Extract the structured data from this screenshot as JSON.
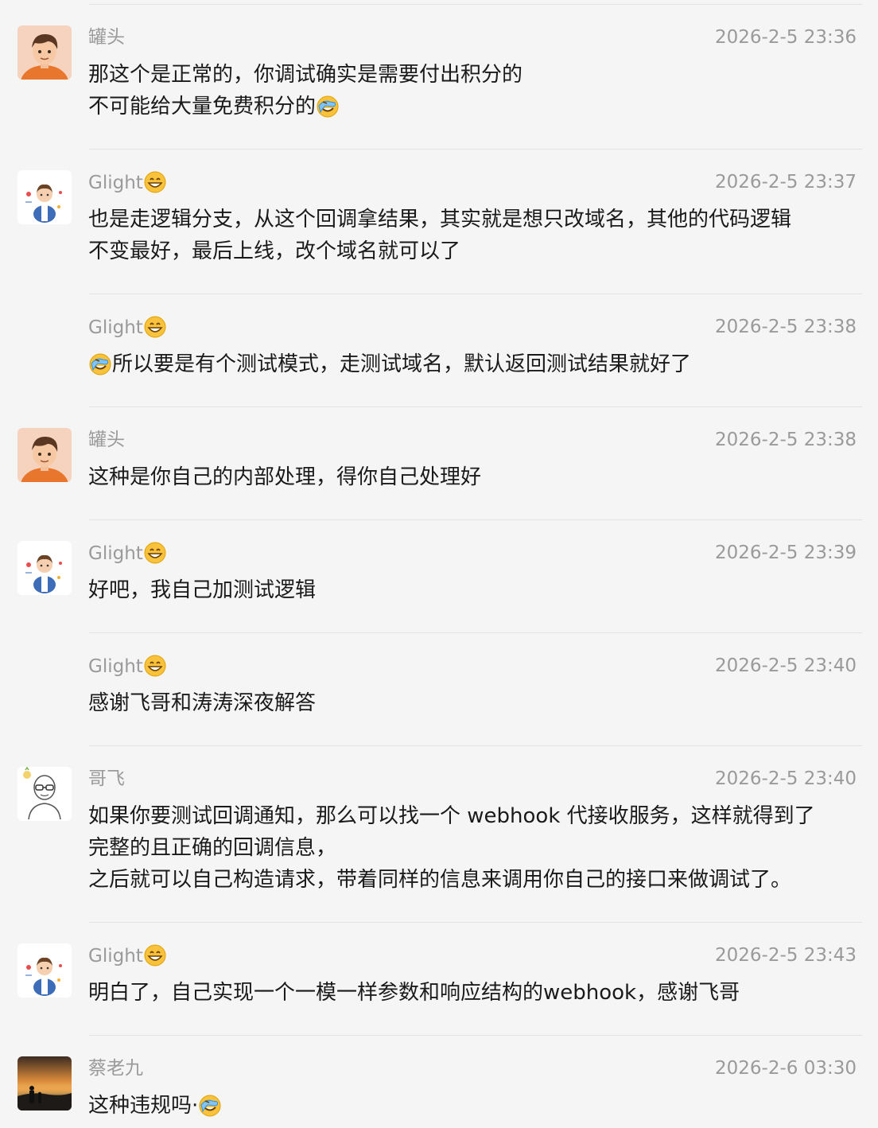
{
  "messages": [
    {
      "name": "罐头",
      "name_emoji": "",
      "avatar": "cartoon-boy-orange-avatar",
      "time": "2026-2-5 23:36",
      "lines": [
        {
          "text": "那这个是正常的，你调试确实是需要付出积分的",
          "emoji": ""
        },
        {
          "text": "不可能给大量免费积分的",
          "emoji": "facepalm"
        }
      ]
    },
    {
      "name": "Glight",
      "name_emoji": "grin",
      "avatar": "cartoon-kid-avatar",
      "time": "2026-2-5 23:37",
      "lines": [
        {
          "text": "也是走逻辑分支，从这个回调拿结果，其实就是想只改域名，其他的代码逻辑",
          "emoji": ""
        },
        {
          "text": "不变最好，最后上线，改个域名就可以了",
          "emoji": ""
        }
      ]
    },
    {
      "name": "Glight",
      "name_emoji": "grin",
      "avatar": "",
      "time": "2026-2-5 23:38",
      "lines": [
        {
          "text": "所以要是有个测试模式，走测试域名，默认返回测试结果就好了",
          "emoji": "",
          "lead_emoji": "facepalm"
        }
      ]
    },
    {
      "name": "罐头",
      "name_emoji": "",
      "avatar": "cartoon-boy-orange-avatar",
      "time": "2026-2-5 23:38",
      "lines": [
        {
          "text": "这种是你自己的内部处理，得你自己处理好",
          "emoji": ""
        }
      ]
    },
    {
      "name": "Glight",
      "name_emoji": "grin",
      "avatar": "cartoon-kid-avatar",
      "time": "2026-2-5 23:39",
      "lines": [
        {
          "text": "好吧，我自己加测试逻辑",
          "emoji": ""
        }
      ]
    },
    {
      "name": "Glight",
      "name_emoji": "grin",
      "avatar": "",
      "time": "2026-2-5 23:40",
      "lines": [
        {
          "text": "感谢飞哥和涛涛深夜解答",
          "emoji": ""
        }
      ]
    },
    {
      "name": "哥飞",
      "name_emoji": "",
      "avatar": "sketch-man-glasses-avatar",
      "time": "2026-2-5 23:40",
      "lines": [
        {
          "text": "如果你要测试回调通知，那么可以找一个 webhook 代接收服务，这样就得到了",
          "emoji": ""
        },
        {
          "text": "完整的且正确的回调信息，",
          "emoji": ""
        },
        {
          "text": "之后就可以自己构造请求，带着同样的信息来调用你自己的接口来做调试了。",
          "emoji": ""
        }
      ]
    },
    {
      "name": "Glight",
      "name_emoji": "grin",
      "avatar": "cartoon-kid-avatar",
      "time": "2026-2-5 23:43",
      "lines": [
        {
          "text": "明白了，自己实现一个一模一样参数和响应结构的webhook，感谢飞哥",
          "emoji": ""
        }
      ]
    },
    {
      "name": "蔡老九",
      "name_emoji": "",
      "avatar": "sunset-silhouette-avatar",
      "time": "2026-2-6 03:30",
      "lines": [
        {
          "text": "这种违规吗·",
          "emoji": "facepalm"
        }
      ]
    }
  ]
}
